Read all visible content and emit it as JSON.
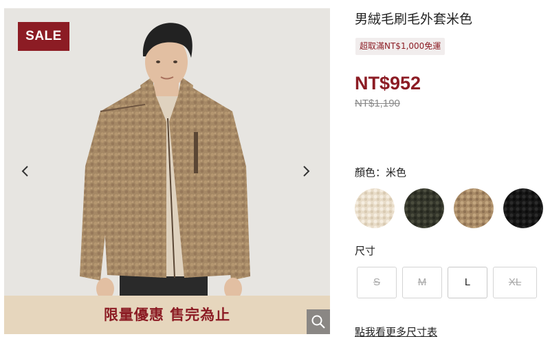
{
  "gallery": {
    "sale_badge": "SALE",
    "promo_banner": "限量優惠 售完為止",
    "prev_icon": "chevron-left-icon",
    "next_icon": "chevron-right-icon",
    "zoom_icon": "search-icon"
  },
  "product": {
    "title": "男絨毛刷毛外套米色",
    "shipping_tag": "超取滿NT$1,000免運",
    "price": "NT$952",
    "original_price": "NT$1,190"
  },
  "color": {
    "label": "顏色：米色",
    "swatches": [
      {
        "name": "cream",
        "hex": "#ede2d1"
      },
      {
        "name": "olive",
        "hex": "#3b3d30"
      },
      {
        "name": "beige",
        "hex": "#b08f6c",
        "selected": true
      },
      {
        "name": "black",
        "hex": "#1c1c1c"
      }
    ]
  },
  "size": {
    "label": "尺寸",
    "options": [
      {
        "label": "S",
        "available": false
      },
      {
        "label": "M",
        "available": false
      },
      {
        "label": "L",
        "available": true
      },
      {
        "label": "XL",
        "available": false
      }
    ]
  },
  "size_chart_link": "點我看更多尺寸表",
  "colors": {
    "brand": "#8c1c24",
    "banner_bg": "#e6d6bd",
    "tag_bg": "#f1eded"
  }
}
